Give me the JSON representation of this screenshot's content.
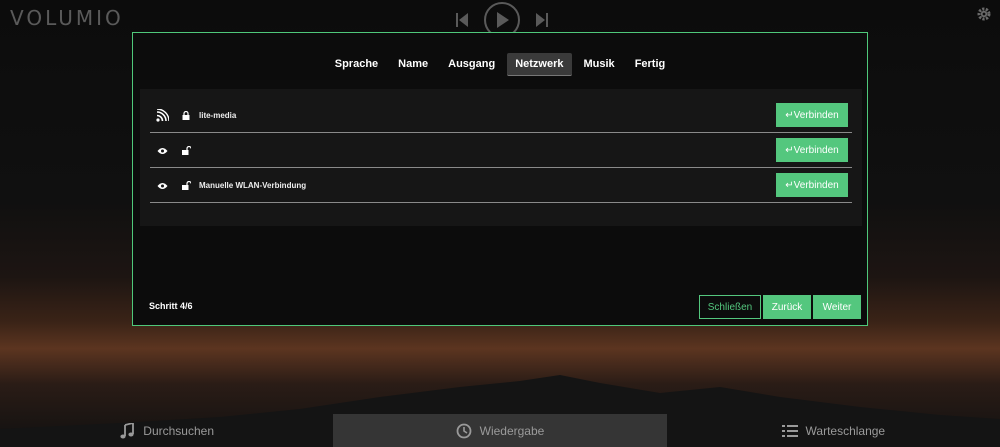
{
  "app": {
    "logo": "VOLUMIO"
  },
  "wizard": {
    "steps": [
      {
        "label": "Sprache"
      },
      {
        "label": "Name"
      },
      {
        "label": "Ausgang"
      },
      {
        "label": "Netzwerk",
        "active": true
      },
      {
        "label": "Musik"
      },
      {
        "label": "Fertig"
      }
    ],
    "networks": [
      {
        "ssid": "lite-media",
        "signal_icon": "wifi-icon",
        "lock_icon": "lock-closed-icon",
        "connect_label": "↵Verbinden"
      },
      {
        "ssid": "",
        "signal_icon": "eye-icon",
        "lock_icon": "lock-open-icon",
        "connect_label": "↵Verbinden"
      },
      {
        "ssid": "Manuelle WLAN-Verbindung",
        "signal_icon": "eye-icon",
        "lock_icon": "lock-open-icon",
        "connect_label": "↵Verbinden"
      }
    ],
    "step_counter": "Schritt 4/6",
    "buttons": {
      "close": "Schließen",
      "back": "Zurück",
      "next": "Weiter"
    }
  },
  "bottom_nav": {
    "browse": "Durchsuchen",
    "playback": "Wiedergabe",
    "queue": "Warteschlange"
  },
  "colors": {
    "accent": "#54c77e",
    "background": "#0c0c0c",
    "panel": "#161616"
  }
}
